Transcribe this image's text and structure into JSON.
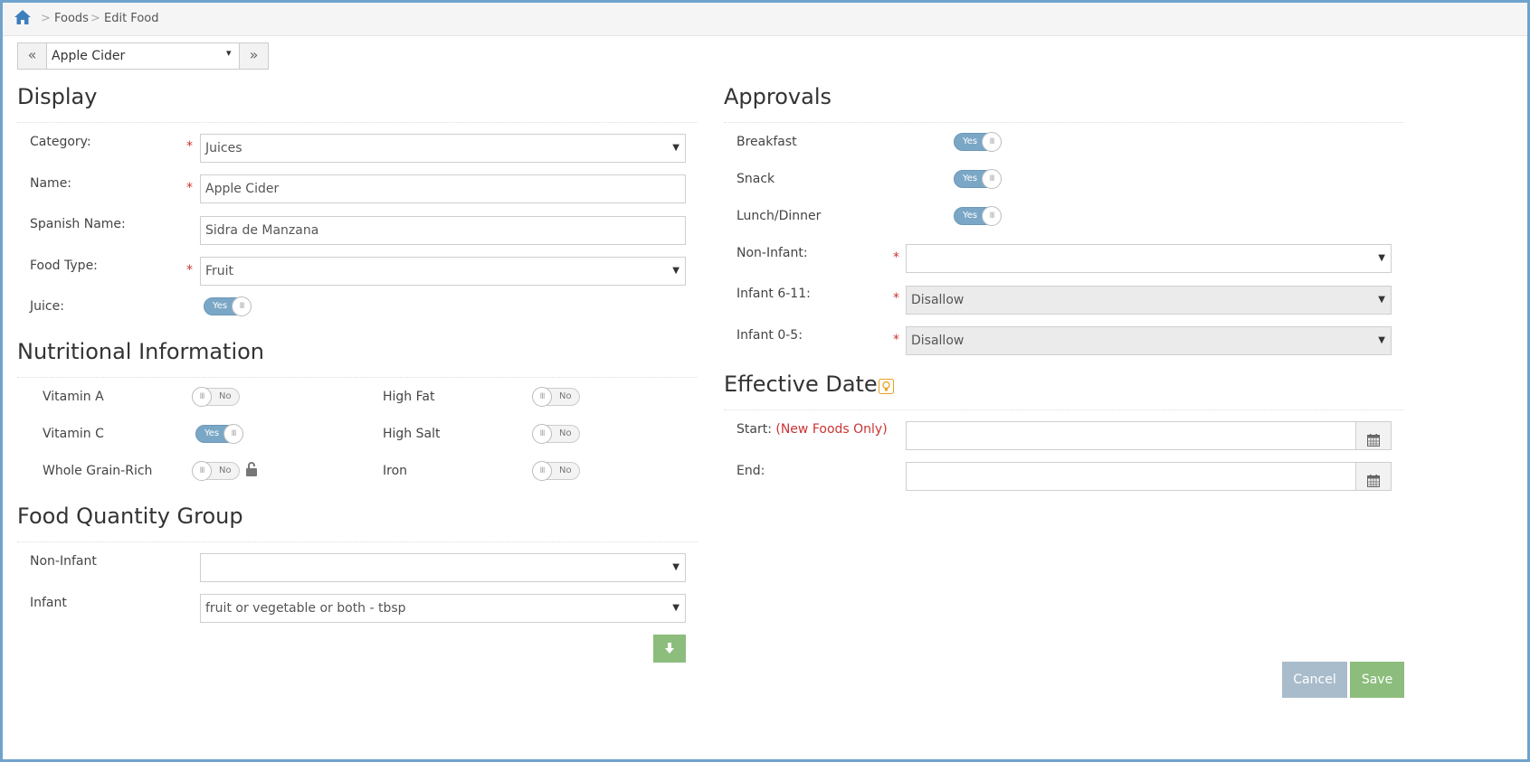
{
  "breadcrumb": {
    "home_icon": "home-icon",
    "items": [
      "Foods",
      "Edit Food"
    ],
    "separator": ">"
  },
  "record_nav": {
    "prev": "«",
    "next": "»",
    "selected": "Apple Cider",
    "caret": "▾"
  },
  "display": {
    "heading": "Display",
    "category": {
      "label": "Category:",
      "value": "Juices"
    },
    "name": {
      "label": "Name:",
      "value": "Apple Cider"
    },
    "spanish_name": {
      "label": "Spanish Name:",
      "value": "Sidra de Manzana"
    },
    "food_type": {
      "label": "Food Type:",
      "value": "Fruit"
    },
    "juice": {
      "label": "Juice:",
      "state": "Yes"
    }
  },
  "nutrition": {
    "heading": "Nutritional Information",
    "items": [
      {
        "label": "Vitamin A",
        "state": "No"
      },
      {
        "label": "High Fat",
        "state": "No"
      },
      {
        "label": "Vitamin C",
        "state": "Yes"
      },
      {
        "label": "High Salt",
        "state": "No"
      },
      {
        "label": "Whole Grain-Rich",
        "state": "No"
      },
      {
        "label": "Iron",
        "state": "No"
      }
    ],
    "lock_icon": "unlock-icon"
  },
  "quantity_group": {
    "heading": "Food Quantity Group",
    "non_infant": {
      "label": "Non-Infant",
      "value": ""
    },
    "infant": {
      "label": "Infant",
      "value": "fruit or vegetable or both - tbsp"
    },
    "down_icon": "arrow-down-icon"
  },
  "approvals": {
    "heading": "Approvals",
    "breakfast": {
      "label": "Breakfast",
      "state": "Yes"
    },
    "snack": {
      "label": "Snack",
      "state": "Yes"
    },
    "lunch_dinner": {
      "label": "Lunch/Dinner",
      "state": "Yes"
    },
    "non_infant": {
      "label": "Non-Infant:",
      "value": ""
    },
    "infant_6_11": {
      "label": "Infant 6-11:",
      "value": "Disallow"
    },
    "infant_0_5": {
      "label": "Infant 0-5:",
      "value": "Disallow"
    }
  },
  "effective_dates": {
    "heading": "Effective Dates",
    "help_icon": "lightbulb-icon",
    "start": {
      "label": "Start:",
      "note": "(New Foods Only)",
      "value": ""
    },
    "end": {
      "label": "End:",
      "value": ""
    },
    "calendar_icon": "calendar-icon"
  },
  "actions": {
    "cancel": "Cancel",
    "save": "Save"
  },
  "required_marker": "*",
  "toggle_knob": "III",
  "colors": {
    "accent": "#7ba7c7",
    "save": "#8cbd7c",
    "cancel": "#a9bccb",
    "required": "#cc3333",
    "frame": "#6fa3cd"
  }
}
